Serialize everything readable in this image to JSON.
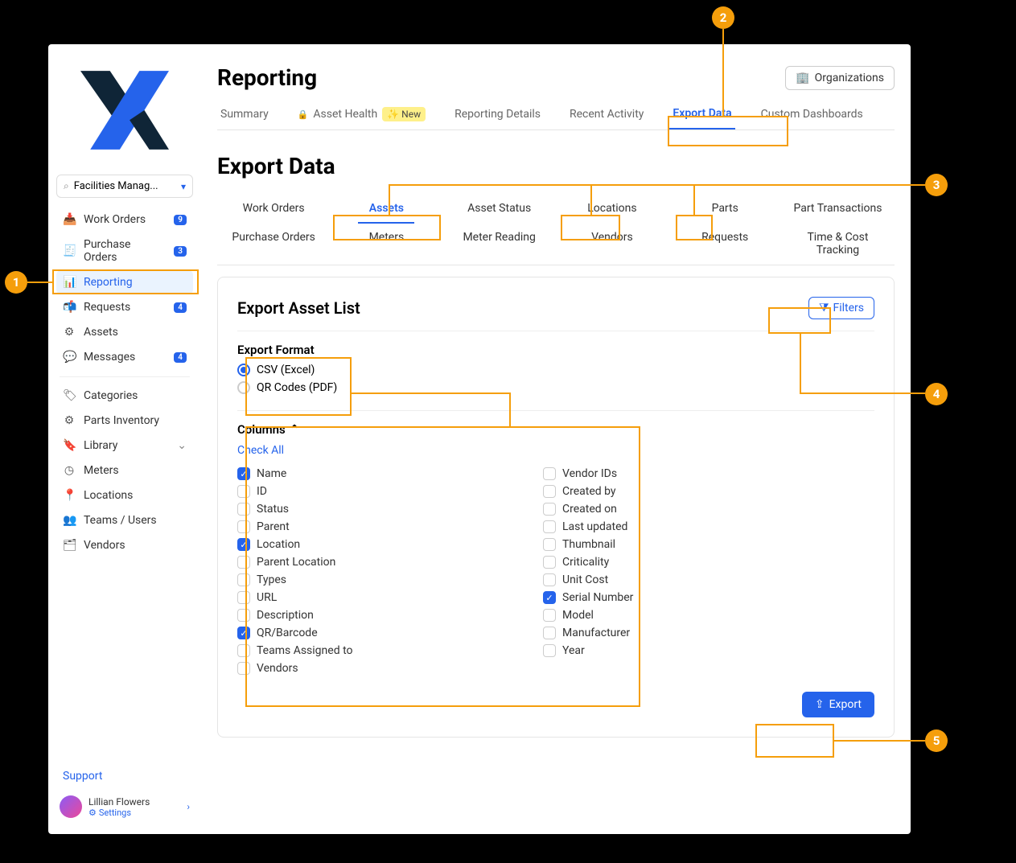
{
  "search": {
    "value": "Facilities Manag..."
  },
  "nav": [
    {
      "label": "Work Orders",
      "icon": "📥",
      "badge": "9"
    },
    {
      "label": "Purchase Orders",
      "icon": "🧾",
      "badge": "3"
    },
    {
      "label": "Reporting",
      "icon": "📊",
      "active": true
    },
    {
      "label": "Requests",
      "icon": "📬",
      "badge": "4"
    },
    {
      "label": "Assets",
      "icon": "⚙",
      "badge": null
    },
    {
      "label": "Messages",
      "icon": "💬",
      "badge": "4"
    }
  ],
  "nav2": [
    {
      "label": "Categories",
      "icon": "🏷"
    },
    {
      "label": "Parts Inventory",
      "icon": "⚙"
    },
    {
      "label": "Library",
      "icon": "🔖",
      "chev": true
    },
    {
      "label": "Meters",
      "icon": "◷"
    },
    {
      "label": "Locations",
      "icon": "📍"
    },
    {
      "label": "Teams / Users",
      "icon": "👥"
    },
    {
      "label": "Vendors",
      "icon": "🗂"
    }
  ],
  "support": "Support",
  "user": {
    "name": "Lillian Flowers",
    "sub": "Settings"
  },
  "page_title": "Reporting",
  "org_btn": "Organizations",
  "tabs": [
    {
      "label": "Summary"
    },
    {
      "label": "Asset Health",
      "lock": true,
      "new": true
    },
    {
      "label": "Reporting Details"
    },
    {
      "label": "Recent Activity"
    },
    {
      "label": "Export Data",
      "active": true
    },
    {
      "label": "Custom Dashboards"
    }
  ],
  "new_label": "New",
  "section_title": "Export Data",
  "subtabs": [
    "Work Orders",
    "Assets",
    "Asset Status",
    "Locations",
    "Parts",
    "Part Transactions",
    "Purchase Orders",
    "Meters",
    "Meter Reading",
    "Vendors",
    "Requests",
    "Time & Cost Tracking"
  ],
  "subtab_active": 1,
  "card": {
    "title": "Export Asset List",
    "filters": "Filters",
    "format_title": "Export Format",
    "formats": [
      {
        "label": "CSV (Excel)",
        "on": true
      },
      {
        "label": "QR Codes (PDF)",
        "on": false
      }
    ],
    "columns_title": "Columns",
    "check_all": "Check All",
    "cols_left": [
      {
        "label": "Name",
        "on": true
      },
      {
        "label": "ID"
      },
      {
        "label": "Status"
      },
      {
        "label": "Parent"
      },
      {
        "label": "Location",
        "on": true
      },
      {
        "label": "Parent Location"
      },
      {
        "label": "Types"
      },
      {
        "label": "URL"
      },
      {
        "label": "Description"
      },
      {
        "label": "QR/Barcode",
        "on": true
      },
      {
        "label": "Teams Assigned to"
      },
      {
        "label": "Vendors"
      }
    ],
    "cols_right": [
      {
        "label": "Vendor IDs"
      },
      {
        "label": "Created by"
      },
      {
        "label": "Created on"
      },
      {
        "label": "Last updated"
      },
      {
        "label": "Thumbnail"
      },
      {
        "label": "Criticality"
      },
      {
        "label": "Unit Cost"
      },
      {
        "label": "Serial Number",
        "on": true
      },
      {
        "label": "Model"
      },
      {
        "label": "Manufacturer"
      },
      {
        "label": "Year"
      }
    ],
    "export_btn": "Export"
  },
  "callouts": [
    "1",
    "2",
    "3",
    "4",
    "5"
  ]
}
